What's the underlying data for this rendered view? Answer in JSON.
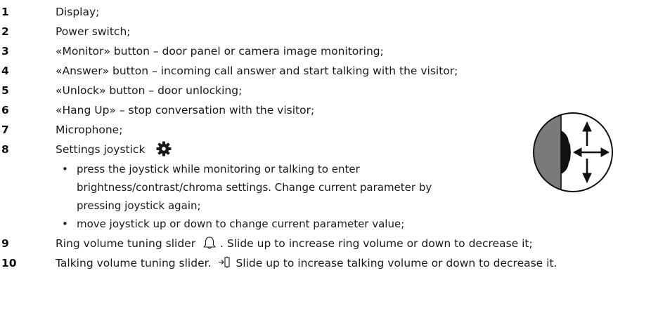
{
  "items": [
    {
      "num": "1",
      "text": "Display;"
    },
    {
      "num": "2",
      "text": "Power switch;"
    },
    {
      "num": "3",
      "text": "«Monitor» button – door panel or camera image monitoring;"
    },
    {
      "num": "4",
      "text": "«Answer» button – incoming call answer and start talking with the visitor;"
    },
    {
      "num": "5",
      "text": "«Unlock» button – door unlocking;"
    },
    {
      "num": "6",
      "text": "«Hang Up» – stop conversation with the visitor;"
    },
    {
      "num": "7",
      "text": "Microphone;"
    },
    {
      "num": "8",
      "text": "Settings joystick",
      "icon": "gear-icon",
      "bullets": [
        [
          "press the joystick while monitoring or talking to enter",
          "brightness/contrast/chroma settings. Change current parameter by",
          "pressing joystick again;"
        ],
        [
          "move joystick up or down to change current parameter value;"
        ]
      ]
    },
    {
      "num": "9",
      "text_before": "Ring volume tuning slider",
      "icon": "bell-icon",
      "text_after": ". Slide up to increase ring volume or down  to decrease it;"
    },
    {
      "num": "10",
      "text_before": "Talking volume tuning slider.",
      "icon": "talk-icon",
      "text_after": "Slide up to increase talking volume or down  to decrease it."
    }
  ],
  "bullet_char": "•",
  "figure": {
    "icon": "joystick-diagram-icon"
  }
}
